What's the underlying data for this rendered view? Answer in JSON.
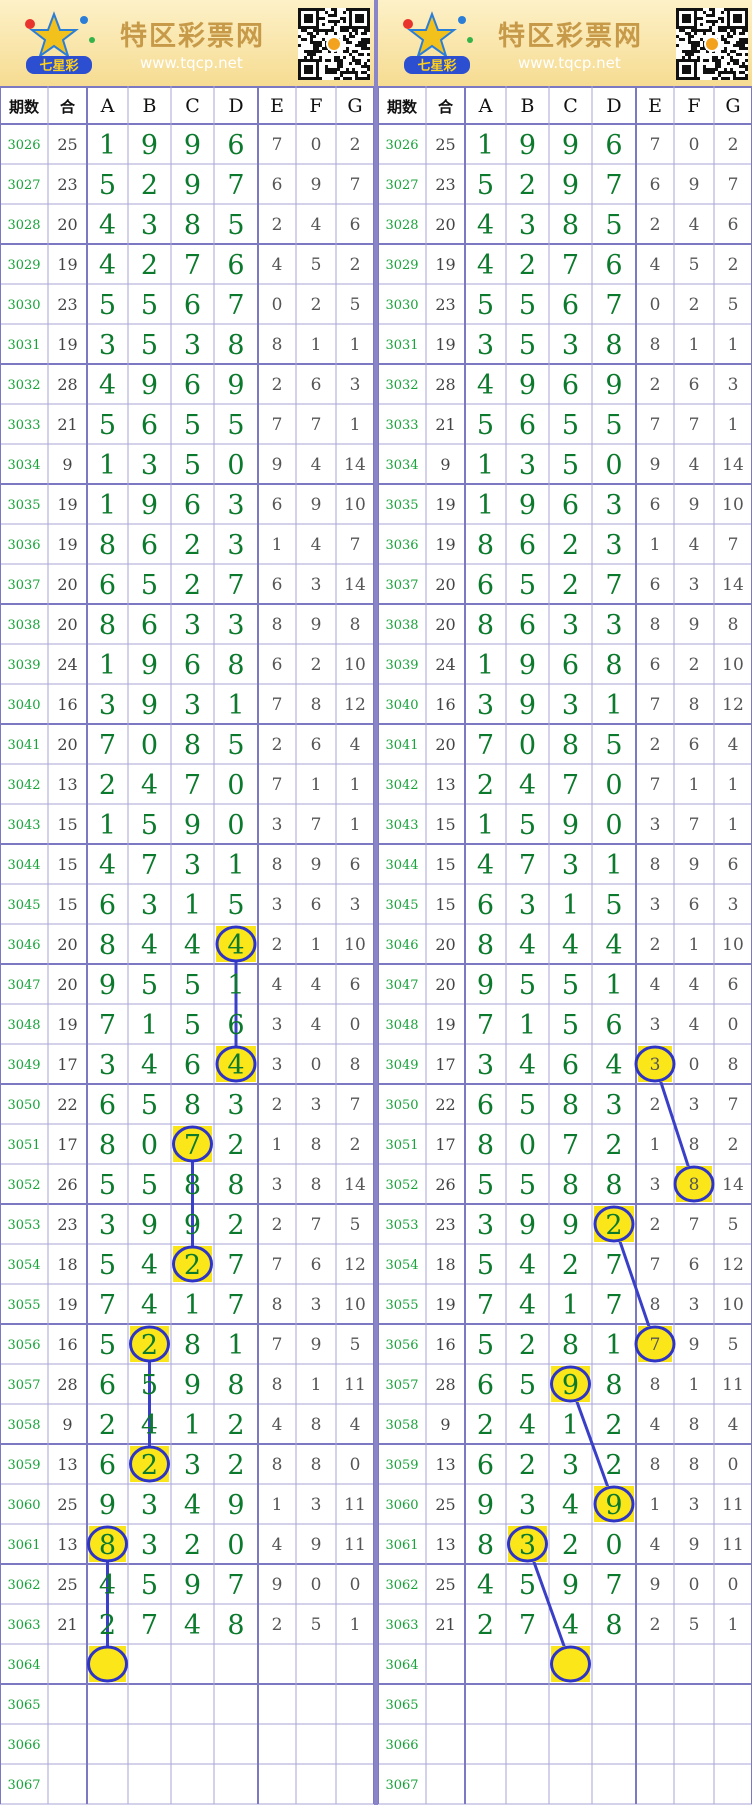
{
  "site": {
    "name": "特区彩票网",
    "url": "www.tqcp.net",
    "logo_text": "七星彩"
  },
  "columns": [
    "期数",
    "合",
    "A",
    "B",
    "C",
    "D",
    "E",
    "F",
    "G"
  ],
  "rows": [
    {
      "issue": "3026",
      "sum": "25",
      "main": [
        "1",
        "9",
        "9",
        "6"
      ],
      "extra": [
        "7",
        "0",
        "2"
      ]
    },
    {
      "issue": "3027",
      "sum": "23",
      "main": [
        "5",
        "2",
        "9",
        "7"
      ],
      "extra": [
        "6",
        "9",
        "7"
      ]
    },
    {
      "issue": "3028",
      "sum": "20",
      "main": [
        "4",
        "3",
        "8",
        "5"
      ],
      "extra": [
        "2",
        "4",
        "6"
      ]
    },
    {
      "issue": "3029",
      "sum": "19",
      "main": [
        "4",
        "2",
        "7",
        "6"
      ],
      "extra": [
        "4",
        "5",
        "2"
      ]
    },
    {
      "issue": "3030",
      "sum": "23",
      "main": [
        "5",
        "5",
        "6",
        "7"
      ],
      "extra": [
        "0",
        "2",
        "5"
      ]
    },
    {
      "issue": "3031",
      "sum": "19",
      "main": [
        "3",
        "5",
        "3",
        "8"
      ],
      "extra": [
        "8",
        "1",
        "1"
      ]
    },
    {
      "issue": "3032",
      "sum": "28",
      "main": [
        "4",
        "9",
        "6",
        "9"
      ],
      "extra": [
        "2",
        "6",
        "3"
      ]
    },
    {
      "issue": "3033",
      "sum": "21",
      "main": [
        "5",
        "6",
        "5",
        "5"
      ],
      "extra": [
        "7",
        "7",
        "1"
      ]
    },
    {
      "issue": "3034",
      "sum": "9",
      "main": [
        "1",
        "3",
        "5",
        "0"
      ],
      "extra": [
        "9",
        "4",
        "14"
      ]
    },
    {
      "issue": "3035",
      "sum": "19",
      "main": [
        "1",
        "9",
        "6",
        "3"
      ],
      "extra": [
        "6",
        "9",
        "10"
      ]
    },
    {
      "issue": "3036",
      "sum": "19",
      "main": [
        "8",
        "6",
        "2",
        "3"
      ],
      "extra": [
        "1",
        "4",
        "7"
      ]
    },
    {
      "issue": "3037",
      "sum": "20",
      "main": [
        "6",
        "5",
        "2",
        "7"
      ],
      "extra": [
        "6",
        "3",
        "14"
      ]
    },
    {
      "issue": "3038",
      "sum": "20",
      "main": [
        "8",
        "6",
        "3",
        "3"
      ],
      "extra": [
        "8",
        "9",
        "8"
      ]
    },
    {
      "issue": "3039",
      "sum": "24",
      "main": [
        "1",
        "9",
        "6",
        "8"
      ],
      "extra": [
        "6",
        "2",
        "10"
      ]
    },
    {
      "issue": "3040",
      "sum": "16",
      "main": [
        "3",
        "9",
        "3",
        "1"
      ],
      "extra": [
        "7",
        "8",
        "12"
      ]
    },
    {
      "issue": "3041",
      "sum": "20",
      "main": [
        "7",
        "0",
        "8",
        "5"
      ],
      "extra": [
        "2",
        "6",
        "4"
      ]
    },
    {
      "issue": "3042",
      "sum": "13",
      "main": [
        "2",
        "4",
        "7",
        "0"
      ],
      "extra": [
        "7",
        "1",
        "1"
      ]
    },
    {
      "issue": "3043",
      "sum": "15",
      "main": [
        "1",
        "5",
        "9",
        "0"
      ],
      "extra": [
        "3",
        "7",
        "1"
      ]
    },
    {
      "issue": "3044",
      "sum": "15",
      "main": [
        "4",
        "7",
        "3",
        "1"
      ],
      "extra": [
        "8",
        "9",
        "6"
      ]
    },
    {
      "issue": "3045",
      "sum": "15",
      "main": [
        "6",
        "3",
        "1",
        "5"
      ],
      "extra": [
        "3",
        "6",
        "3"
      ]
    },
    {
      "issue": "3046",
      "sum": "20",
      "main": [
        "8",
        "4",
        "4",
        "4"
      ],
      "extra": [
        "2",
        "1",
        "10"
      ]
    },
    {
      "issue": "3047",
      "sum": "20",
      "main": [
        "9",
        "5",
        "5",
        "1"
      ],
      "extra": [
        "4",
        "4",
        "6"
      ]
    },
    {
      "issue": "3048",
      "sum": "19",
      "main": [
        "7",
        "1",
        "5",
        "6"
      ],
      "extra": [
        "3",
        "4",
        "0"
      ]
    },
    {
      "issue": "3049",
      "sum": "17",
      "main": [
        "3",
        "4",
        "6",
        "4"
      ],
      "extra": [
        "3",
        "0",
        "8"
      ]
    },
    {
      "issue": "3050",
      "sum": "22",
      "main": [
        "6",
        "5",
        "8",
        "3"
      ],
      "extra": [
        "2",
        "3",
        "7"
      ]
    },
    {
      "issue": "3051",
      "sum": "17",
      "main": [
        "8",
        "0",
        "7",
        "2"
      ],
      "extra": [
        "1",
        "8",
        "2"
      ]
    },
    {
      "issue": "3052",
      "sum": "26",
      "main": [
        "5",
        "5",
        "8",
        "8"
      ],
      "extra": [
        "3",
        "8",
        "14"
      ]
    },
    {
      "issue": "3053",
      "sum": "23",
      "main": [
        "3",
        "9",
        "9",
        "2"
      ],
      "extra": [
        "2",
        "7",
        "5"
      ]
    },
    {
      "issue": "3054",
      "sum": "18",
      "main": [
        "5",
        "4",
        "2",
        "7"
      ],
      "extra": [
        "7",
        "6",
        "12"
      ]
    },
    {
      "issue": "3055",
      "sum": "19",
      "main": [
        "7",
        "4",
        "1",
        "7"
      ],
      "extra": [
        "8",
        "3",
        "10"
      ]
    },
    {
      "issue": "3056",
      "sum": "16",
      "main": [
        "5",
        "2",
        "8",
        "1"
      ],
      "extra": [
        "7",
        "9",
        "5"
      ]
    },
    {
      "issue": "3057",
      "sum": "28",
      "main": [
        "6",
        "5",
        "9",
        "8"
      ],
      "extra": [
        "8",
        "1",
        "11"
      ]
    },
    {
      "issue": "3058",
      "sum": "9",
      "main": [
        "2",
        "4",
        "1",
        "2"
      ],
      "extra": [
        "4",
        "8",
        "4"
      ]
    },
    {
      "issue": "3059",
      "sum": "13",
      "main": [
        "6",
        "2",
        "3",
        "2"
      ],
      "extra": [
        "8",
        "8",
        "0"
      ]
    },
    {
      "issue": "3060",
      "sum": "25",
      "main": [
        "9",
        "3",
        "4",
        "9"
      ],
      "extra": [
        "1",
        "3",
        "11"
      ]
    },
    {
      "issue": "3061",
      "sum": "13",
      "main": [
        "8",
        "3",
        "2",
        "0"
      ],
      "extra": [
        "4",
        "9",
        "11"
      ]
    },
    {
      "issue": "3062",
      "sum": "25",
      "main": [
        "4",
        "5",
        "9",
        "7"
      ],
      "extra": [
        "9",
        "0",
        "0"
      ]
    },
    {
      "issue": "3063",
      "sum": "21",
      "main": [
        "2",
        "7",
        "4",
        "8"
      ],
      "extra": [
        "2",
        "5",
        "1"
      ]
    },
    {
      "issue": "3064",
      "sum": "",
      "main": [
        "",
        "",
        "",
        ""
      ],
      "extra": [
        "",
        "",
        ""
      ]
    },
    {
      "issue": "3065",
      "sum": "",
      "main": [
        "",
        "",
        "",
        ""
      ],
      "extra": [
        "",
        "",
        ""
      ]
    },
    {
      "issue": "3066",
      "sum": "",
      "main": [
        "",
        "",
        "",
        ""
      ],
      "extra": [
        "",
        "",
        ""
      ]
    },
    {
      "issue": "3067",
      "sum": "",
      "main": [
        "",
        "",
        "",
        ""
      ],
      "extra": [
        "",
        "",
        ""
      ]
    }
  ],
  "panels": [
    {
      "name": "left",
      "highlights": [
        {
          "row": 20,
          "col": "D"
        },
        {
          "row": 23,
          "col": "D"
        },
        {
          "row": 25,
          "col": "C"
        },
        {
          "row": 28,
          "col": "C"
        },
        {
          "row": 30,
          "col": "B"
        },
        {
          "row": 33,
          "col": "B"
        },
        {
          "row": 35,
          "col": "A"
        },
        {
          "row": 38,
          "col": "A"
        }
      ],
      "links": [
        [
          {
            "row": 20,
            "col": "D"
          },
          {
            "row": 23,
            "col": "D"
          }
        ],
        [
          {
            "row": 25,
            "col": "C"
          },
          {
            "row": 28,
            "col": "C"
          }
        ],
        [
          {
            "row": 30,
            "col": "B"
          },
          {
            "row": 33,
            "col": "B"
          }
        ],
        [
          {
            "row": 35,
            "col": "A"
          },
          {
            "row": 38,
            "col": "A"
          }
        ]
      ]
    },
    {
      "name": "right",
      "highlights": [
        {
          "row": 23,
          "col": "E"
        },
        {
          "row": 26,
          "col": "F"
        },
        {
          "row": 27,
          "col": "D"
        },
        {
          "row": 30,
          "col": "E"
        },
        {
          "row": 31,
          "col": "C"
        },
        {
          "row": 34,
          "col": "D"
        },
        {
          "row": 35,
          "col": "B"
        },
        {
          "row": 38,
          "col": "C"
        }
      ],
      "links": [
        [
          {
            "row": 23,
            "col": "E"
          },
          {
            "row": 26,
            "col": "F"
          }
        ],
        [
          {
            "row": 27,
            "col": "D"
          },
          {
            "row": 30,
            "col": "E"
          }
        ],
        [
          {
            "row": 31,
            "col": "C"
          },
          {
            "row": 34,
            "col": "D"
          }
        ],
        [
          {
            "row": 35,
            "col": "B"
          },
          {
            "row": 38,
            "col": "C"
          }
        ]
      ]
    }
  ],
  "colors": {
    "issue_text": "#17a33a",
    "sum_text": "#444444",
    "main_text": "#0c7a2c",
    "extra_text": "#555555",
    "grid_line": "#a9a6d6",
    "thick_line": "#7d78c2",
    "highlight_fill": "#fbe61a",
    "highlight_ring": "#2e35c6",
    "link_line": "#3a3fc8"
  }
}
